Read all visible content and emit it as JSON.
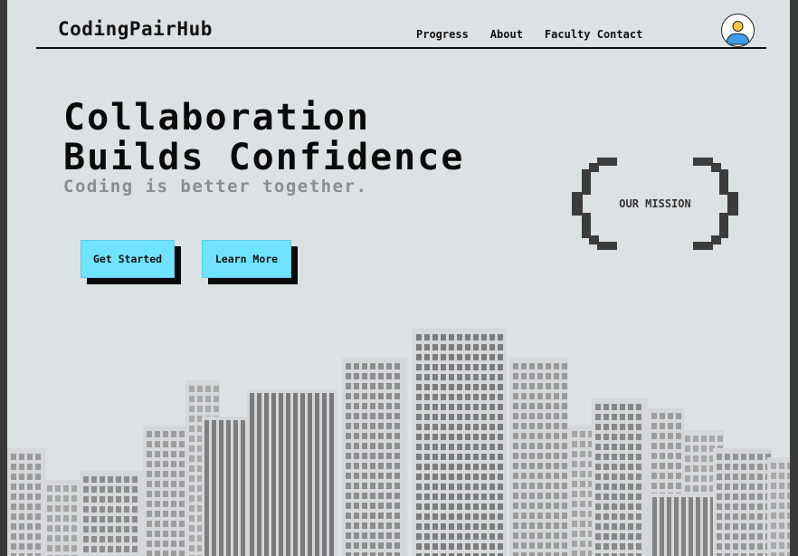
{
  "header": {
    "brand": "CodingPairHub",
    "nav": [
      "Progress",
      "About",
      "Faculty Contact"
    ]
  },
  "hero": {
    "title_line1": "Collaboration",
    "title_line2": "Builds Confidence",
    "tagline": "Coding is better together.",
    "primary_button": "Get Started",
    "secondary_button": "Learn More"
  },
  "mission": {
    "label": "OUR MISSION"
  },
  "colors": {
    "background": "#dce1e3",
    "accent": "#6fe3ff",
    "text": "#111111",
    "tagline": "#8a8d8f",
    "buildings": "#6b6b6b"
  },
  "icons": {
    "avatar": "user-avatar-icon",
    "brackets": "pixel-curly-brace-icon",
    "skyline": "city-skyline-illustration"
  }
}
